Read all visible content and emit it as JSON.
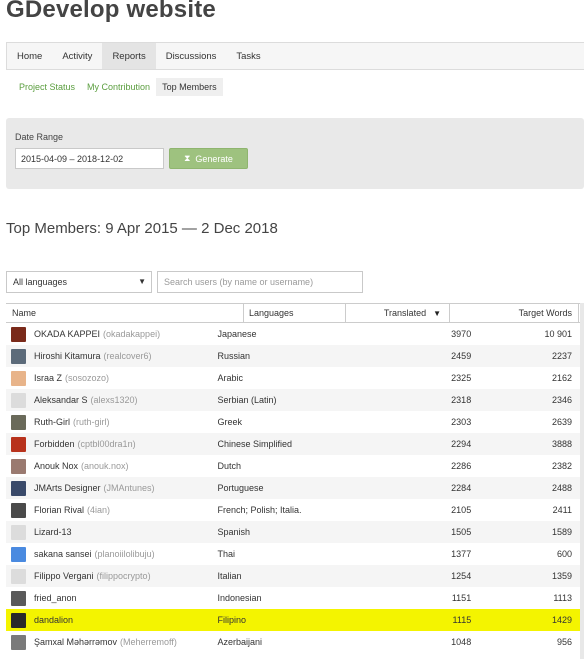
{
  "page": {
    "title": "GDevelop website"
  },
  "main_nav": [
    {
      "label": "Home",
      "active": false
    },
    {
      "label": "Activity",
      "active": false
    },
    {
      "label": "Reports",
      "active": true
    },
    {
      "label": "Discussions",
      "active": false
    },
    {
      "label": "Tasks",
      "active": false
    }
  ],
  "sub_nav": [
    {
      "label": "Project Status",
      "active": false
    },
    {
      "label": "My Contribution",
      "active": false
    },
    {
      "label": "Top Members",
      "active": true
    }
  ],
  "date_range": {
    "label": "Date Range",
    "value": "2015-04-09 – 2018-12-02",
    "generate_label": "Generate",
    "generate_icon": "hourglass-icon"
  },
  "section": {
    "title": "Top Members: 9 Apr 2015 — 2 Dec 2018"
  },
  "filters": {
    "language_value": "All languages",
    "search_placeholder": "Search users (by name or username)"
  },
  "table": {
    "headers": {
      "name": "Name",
      "languages": "Languages",
      "translated": "Translated",
      "target_words": "Target Words"
    },
    "sort_column": "translated",
    "sort_direction": "desc",
    "rows": [
      {
        "name": "OKADA KAPPEI",
        "handle": "(okadakappei)",
        "languages": "Japanese",
        "translated": "3970",
        "target_words": "10 901",
        "avatar_color": "#7a2a1a"
      },
      {
        "name": "Hiroshi Kitamura",
        "handle": "(realcover6)",
        "languages": "Russian",
        "translated": "2459",
        "target_words": "2237",
        "avatar_color": "#5c6b7a"
      },
      {
        "name": "Israa Z",
        "handle": "(sosozozo)",
        "languages": "Arabic",
        "translated": "2325",
        "target_words": "2162",
        "avatar_color": "#e8b48a"
      },
      {
        "name": "Aleksandar S",
        "handle": "(alexs1320)",
        "languages": "Serbian (Latin)",
        "translated": "2318",
        "target_words": "2346",
        "avatar_color": "#dcdcdc"
      },
      {
        "name": "Ruth-Girl",
        "handle": "(ruth-girl)",
        "languages": "Greek",
        "translated": "2303",
        "target_words": "2639",
        "avatar_color": "#6a6a5a"
      },
      {
        "name": "Forbidden",
        "handle": "(cptbl00dra1n)",
        "languages": "Chinese Simplified",
        "translated": "2294",
        "target_words": "3888",
        "avatar_color": "#b8321c"
      },
      {
        "name": "Anouk Nox",
        "handle": "(anouk.nox)",
        "languages": "Dutch",
        "translated": "2286",
        "target_words": "2382",
        "avatar_color": "#9a7a70"
      },
      {
        "name": "JMArts Designer",
        "handle": "(JMAntunes)",
        "languages": "Portuguese",
        "translated": "2284",
        "target_words": "2488",
        "avatar_color": "#3a4a6a"
      },
      {
        "name": "Florian Rival",
        "handle": "(4ian)",
        "languages": "French; Polish; Italia...",
        "translated": "2105",
        "target_words": "2411",
        "avatar_color": "#4a4a4a"
      },
      {
        "name": "Lizard-13",
        "handle": "",
        "languages": "Spanish",
        "translated": "1505",
        "target_words": "1589",
        "avatar_color": "#dcdcdc"
      },
      {
        "name": "sakana sansei",
        "handle": "(planoiilolibuju)",
        "languages": "Thai",
        "translated": "1377",
        "target_words": "600",
        "avatar_color": "#4a8ae0"
      },
      {
        "name": "Filippo Vergani",
        "handle": "(filippocrypto)",
        "languages": "Italian",
        "translated": "1254",
        "target_words": "1359",
        "avatar_color": "#dcdcdc"
      },
      {
        "name": "fried_anon",
        "handle": "",
        "languages": "Indonesian",
        "translated": "1151",
        "target_words": "1113",
        "avatar_color": "#5a5a5a"
      },
      {
        "name": "dandalion",
        "handle": "",
        "languages": "Filipino",
        "translated": "1115",
        "target_words": "1429",
        "avatar_color": "#2a2a2a",
        "highlighted": true
      },
      {
        "name": "Şamxal Məhərrəmov",
        "handle": "(Meherremoff)",
        "languages": "Azerbaijani",
        "translated": "1048",
        "target_words": "956",
        "avatar_color": "#7a7a7a"
      }
    ]
  }
}
